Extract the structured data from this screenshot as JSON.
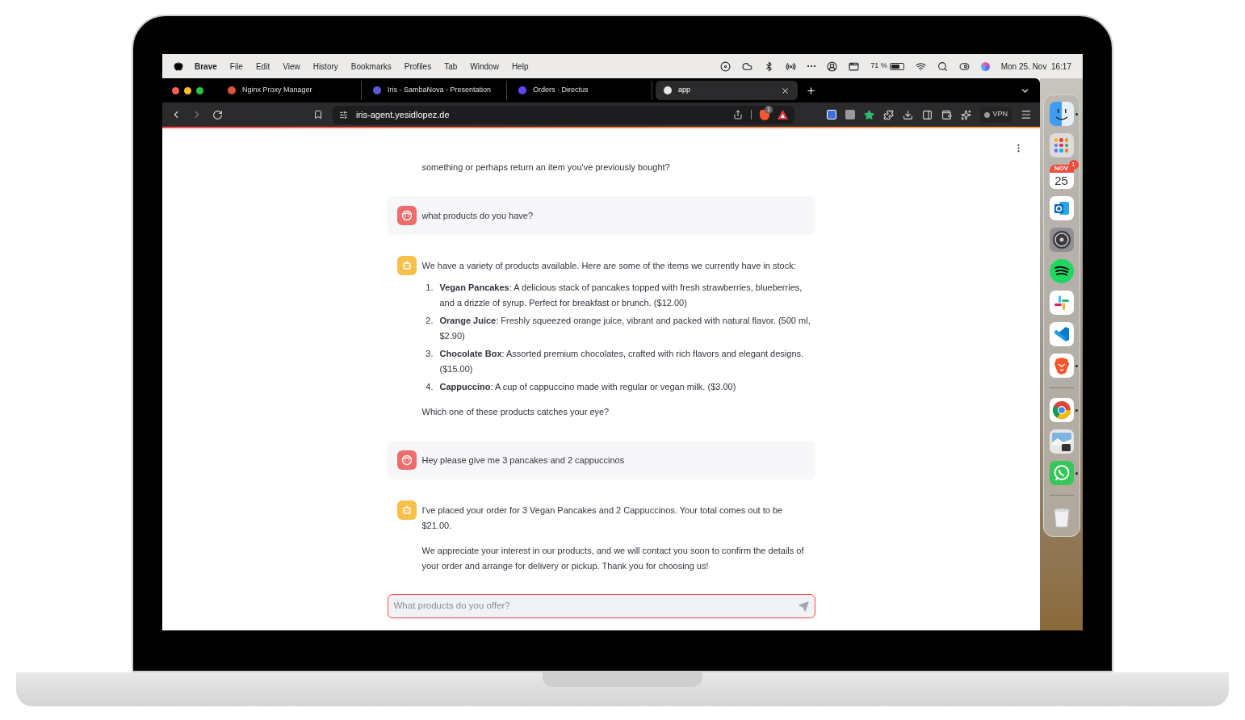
{
  "menu_bar": {
    "app": "Brave",
    "items": [
      "File",
      "Edit",
      "View",
      "History",
      "Bookmarks",
      "Profiles",
      "Tab",
      "Window",
      "Help"
    ],
    "battery": "71 %",
    "clock": "Mon 25. Nov  16:17"
  },
  "tabs": [
    {
      "title": "Nginx Proxy Manager",
      "selected": false,
      "color": "#e0533d"
    },
    {
      "title": "Iris - SambaNova - Presentation",
      "selected": false,
      "color": "#5b5bd6"
    },
    {
      "title": "Orders · Directus",
      "selected": false,
      "color": "#6644ff"
    },
    {
      "title": "app",
      "selected": true,
      "color": "#e6e6e6"
    }
  ],
  "address_bar": {
    "url": "iris-agent.yesidlopez.de",
    "shields_badge": "1"
  },
  "vpn": "VPN",
  "chat": {
    "messages": [
      {
        "kind": "assistant",
        "avatar": false,
        "blocks": [
          {
            "kind": "paragraph",
            "text": "something or perhaps return an item you've previously bought?"
          }
        ]
      },
      {
        "kind": "user",
        "avatar": true,
        "blocks": [
          {
            "kind": "paragraph",
            "text": "what products do you have?"
          }
        ]
      },
      {
        "kind": "assistant",
        "avatar": true,
        "blocks": [
          {
            "kind": "paragraph",
            "text": "We have a variety of products available. Here are some of the items we currently have in stock:"
          },
          {
            "kind": "list",
            "items": [
              {
                "number": "1.",
                "text": "**Vegan Pancakes**: A delicious stack of pancakes topped with fresh strawberries, blueberries, and a drizzle of syrup. Perfect for breakfast or brunch. ($12.00)"
              },
              {
                "number": "2.",
                "text": "**Orange Juice**: Freshly squeezed orange juice, vibrant and packed with natural flavor. (500 ml, $2.90)"
              },
              {
                "number": "3.",
                "text": "**Chocolate Box**: Assorted premium chocolates, crafted with rich flavors and elegant designs. ($15.00)"
              },
              {
                "number": "4.",
                "text": "**Cappuccino**: A cup of cappuccino made with regular or vegan milk. ($3.00)"
              }
            ]
          },
          {
            "kind": "paragraph",
            "text": "Which one of these products catches your eye?"
          }
        ]
      },
      {
        "kind": "user",
        "avatar": true,
        "blocks": [
          {
            "kind": "paragraph",
            "text": "Hey please give me 3 pancakes and 2 cappuccinos"
          }
        ]
      },
      {
        "kind": "assistant",
        "avatar": true,
        "blocks": [
          {
            "kind": "paragraph",
            "text": "I've placed your order for 3 Vegan Pancakes and 2 Cappuccinos. Your total comes out to be $21.00."
          },
          {
            "kind": "paragraph",
            "text": "We appreciate your interest in our products, and we will contact you soon to confirm the details of your order and arrange for delivery or pickup. Thank you for choosing us!"
          }
        ]
      }
    ],
    "input": {
      "placeholder": "What products do you offer?"
    }
  },
  "dock": [
    {
      "kind": "finder",
      "running": true
    },
    {
      "kind": "launchpad",
      "running": false
    },
    {
      "kind": "calendar",
      "running": false,
      "month": "NOV",
      "day": "25",
      "badge": "1"
    },
    {
      "kind": "mail",
      "running": false
    },
    {
      "kind": "settings",
      "running": false
    },
    {
      "kind": "music",
      "running": false
    },
    {
      "kind": "chat",
      "running": false
    },
    {
      "kind": "code",
      "running": false
    },
    {
      "kind": "lion",
      "running": true
    },
    {
      "kind": "separator"
    },
    {
      "kind": "browser",
      "running": true
    },
    {
      "kind": "photo",
      "running": false
    },
    {
      "kind": "phone",
      "running": true
    },
    {
      "kind": "separator"
    },
    {
      "kind": "trash",
      "running": false
    }
  ]
}
